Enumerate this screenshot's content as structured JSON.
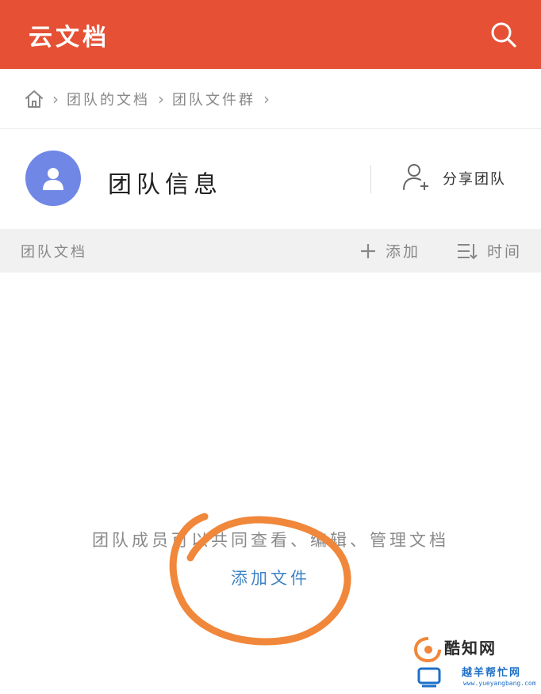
{
  "app": {
    "title": "云文档",
    "accent_color": "#e65035",
    "search_icon": "search-icon"
  },
  "breadcrumb": {
    "home_icon": "home-icon",
    "items": [
      {
        "label": "团队的文档"
      },
      {
        "label": "团队文件群"
      }
    ]
  },
  "team": {
    "avatar_icon": "user-avatar-icon",
    "avatar_color": "#7087e5",
    "title": "团队信息",
    "share_label": "分享团队",
    "share_icon": "add-user-icon"
  },
  "section": {
    "title": "团队文档",
    "add_label": "添加",
    "add_icon": "plus-icon",
    "sort_label": "时间",
    "sort_icon": "sort-icon"
  },
  "empty_state": {
    "message": "团队成员可以共同查看、编辑、管理文档",
    "action_label": "添加文件",
    "link_color": "#3d83c6",
    "annotation_color": "#f0873a"
  },
  "watermark": {
    "title": "酷知网",
    "subtitle": "越羊帮忙网",
    "url": "www.yueyangbang.com"
  }
}
